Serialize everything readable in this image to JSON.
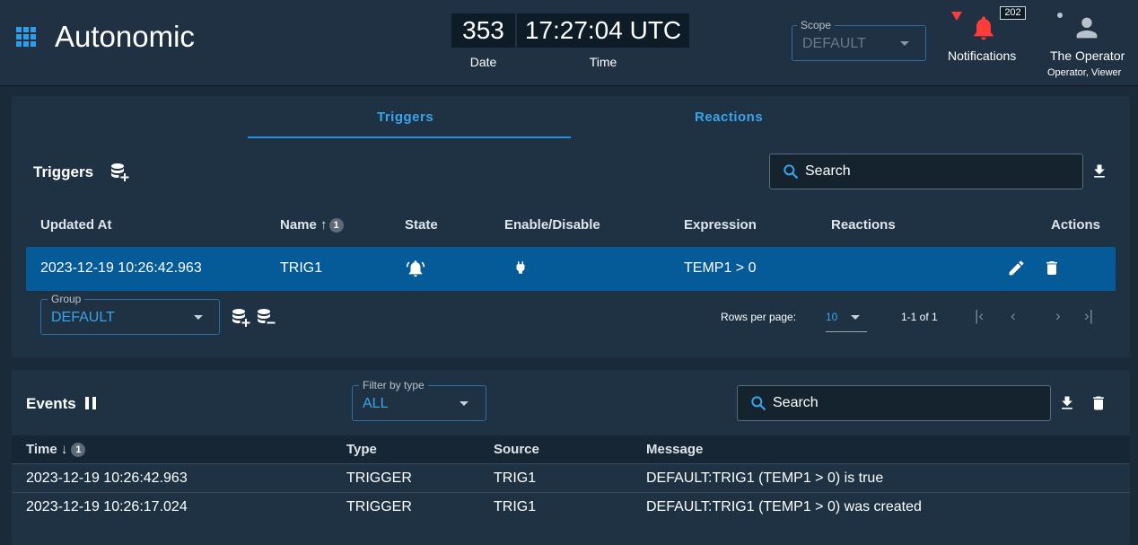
{
  "header": {
    "app_title": "Autonomic",
    "date_value": "353",
    "date_label": "Date",
    "time_value": "17:27:04 UTC",
    "time_label": "Time",
    "scope_label": "Scope",
    "scope_value": "DEFAULT",
    "notifications_count": "202",
    "notifications_label": "Notifications",
    "user_name": "The Operator",
    "user_role": "Operator, Viewer"
  },
  "tabs": [
    {
      "label": "Triggers",
      "active": true
    },
    {
      "label": "Reactions",
      "active": false
    }
  ],
  "triggers": {
    "title": "Triggers",
    "search_placeholder": "Search",
    "columns": [
      "Updated At",
      "Name",
      "State",
      "Enable/Disable",
      "Expression",
      "Reactions",
      "Actions"
    ],
    "sort_index": "1",
    "rows": [
      {
        "updated_at": "2023-12-19 10:26:42.963",
        "name": "TRIG1",
        "expression": "TEMP1 > 0",
        "reactions": ""
      }
    ],
    "group_label": "Group",
    "group_value": "DEFAULT",
    "rows_per_page_label": "Rows per page:",
    "rows_per_page_value": "10",
    "range_text": "1-1 of 1"
  },
  "events": {
    "title": "Events",
    "filter_label": "Filter by type",
    "filter_value": "ALL",
    "search_placeholder": "Search",
    "columns": [
      "Time",
      "Type",
      "Source",
      "Message"
    ],
    "sort_index": "1",
    "rows": [
      {
        "time": "2023-12-19 10:26:42.963",
        "type": "TRIGGER",
        "source": "TRIG1",
        "message": "DEFAULT:TRIG1 (TEMP1 > 0) is true"
      },
      {
        "time": "2023-12-19 10:26:17.024",
        "type": "TRIGGER",
        "source": "TRIG1",
        "message": "DEFAULT:TRIG1 (TEMP1 > 0) was created"
      }
    ]
  },
  "colors": {
    "accent": "#3aa3ec",
    "selected_row": "#055b97",
    "alert": "#ff3b3b"
  },
  "icons": [
    "apps-grid-icon",
    "bell-icon",
    "account-icon",
    "database-plus-icon",
    "database-minus-icon",
    "search-icon",
    "download-icon",
    "delete-icon",
    "pencil-icon",
    "alarm-bell-icon",
    "plug-icon",
    "pause-icon"
  ]
}
